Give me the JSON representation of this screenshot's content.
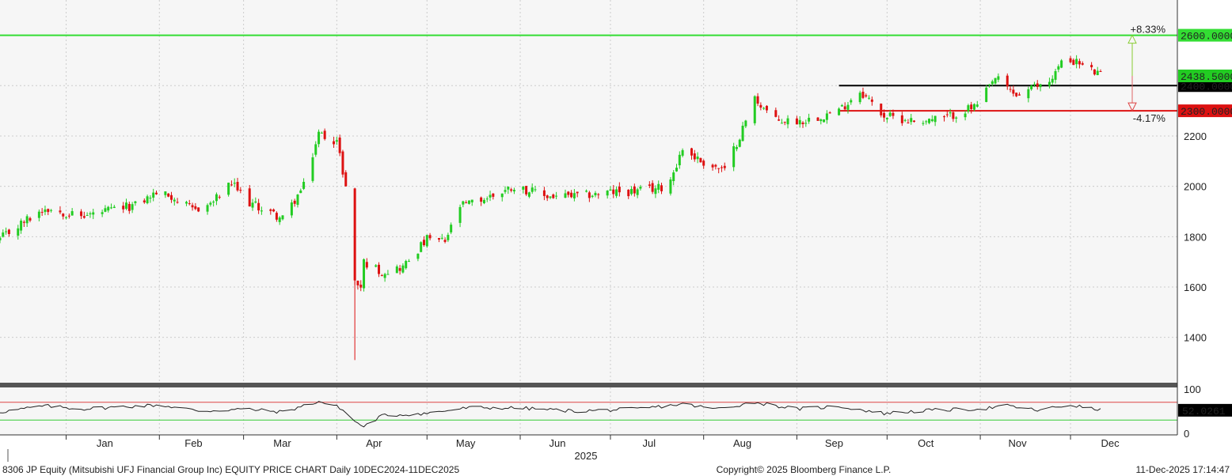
{
  "chart_data": [
    {
      "type": "candlestick",
      "title": "",
      "x_range": [
        "2024-12-10",
        "2025-12-11"
      ],
      "ylim": [
        1220,
        2740
      ],
      "y_ticks": [
        1400,
        1600,
        1800,
        2000,
        2200
      ],
      "y_tick_labels": [
        "1400",
        "1600",
        "1800",
        "2000",
        "2200"
      ],
      "month_ticks": [
        {
          "date": "2025-01-01",
          "label": "Jan"
        },
        {
          "date": "2025-02-01",
          "label": "Feb"
        },
        {
          "date": "2025-03-01",
          "label": "Mar"
        },
        {
          "date": "2025-04-01",
          "label": "Apr"
        },
        {
          "date": "2025-05-01",
          "label": "May"
        },
        {
          "date": "2025-06-01",
          "label": "Jun"
        },
        {
          "date": "2025-07-01",
          "label": "Jul"
        },
        {
          "date": "2025-08-01",
          "label": "Aug"
        },
        {
          "date": "2025-09-01",
          "label": "Sep"
        },
        {
          "date": "2025-10-01",
          "label": "Oct"
        },
        {
          "date": "2025-11-01",
          "label": "Nov"
        },
        {
          "date": "2025-12-01",
          "label": "Dec"
        }
      ],
      "year_label": "2025",
      "colors": {
        "up": "#22cc22",
        "down": "#dd1111",
        "resistance": "#33dd33",
        "support_black": "#000000",
        "support_red": "#dd1111"
      },
      "levels": [
        {
          "value": 2600,
          "label": "2600.0000",
          "color": "#33dd33",
          "from": "2024-12-10"
        },
        {
          "value": 2400,
          "label": "2400.0000",
          "color": "#000000",
          "from": "2025-09-15"
        },
        {
          "value": 2300,
          "label": "2300.0000",
          "color": "#dd1111",
          "from": "2025-09-15"
        }
      ],
      "last_price": {
        "value": 2438.5,
        "label": "2438.5000"
      },
      "pct_annotations": [
        {
          "text": "+8.33%",
          "value": 2600,
          "color": "#88bb22"
        },
        {
          "text": "-4.17%",
          "value": 2300,
          "color": "#dd1111"
        }
      ],
      "anchors": [
        [
          "2024-12-10",
          1790
        ],
        [
          "2024-12-18",
          1860
        ],
        [
          "2024-12-25",
          1915
        ],
        [
          "2025-01-06",
          1880
        ],
        [
          "2025-01-14",
          1900
        ],
        [
          "2025-01-24",
          1925
        ],
        [
          "2025-01-31",
          1975
        ],
        [
          "2025-02-05",
          1960
        ],
        [
          "2025-02-12",
          1905
        ],
        [
          "2025-02-18",
          1930
        ],
        [
          "2025-02-25",
          2010
        ],
        [
          "2025-03-03",
          1935
        ],
        [
          "2025-03-10",
          1895
        ],
        [
          "2025-03-14",
          1870
        ],
        [
          "2025-03-21",
          2000
        ],
        [
          "2025-03-26",
          2210
        ],
        [
          "2025-04-01",
          2180
        ],
        [
          "2025-04-04",
          2000
        ],
        [
          "2025-04-07",
          1620
        ],
        [
          "2025-04-09",
          1600
        ],
        [
          "2025-04-10",
          1700
        ],
        [
          "2025-04-16",
          1660
        ],
        [
          "2025-04-23",
          1680
        ],
        [
          "2025-05-01",
          1790
        ],
        [
          "2025-05-07",
          1780
        ],
        [
          "2025-05-12",
          1920
        ],
        [
          "2025-05-20",
          1950
        ],
        [
          "2025-05-30",
          2000
        ],
        [
          "2025-06-10",
          1960
        ],
        [
          "2025-06-20",
          1960
        ],
        [
          "2025-06-30",
          1975
        ],
        [
          "2025-07-10",
          1980
        ],
        [
          "2025-07-20",
          2000
        ],
        [
          "2025-07-25",
          2150
        ],
        [
          "2025-07-31",
          2100
        ],
        [
          "2025-08-08",
          2060
        ],
        [
          "2025-08-14",
          2230
        ],
        [
          "2025-08-18",
          2350
        ],
        [
          "2025-08-25",
          2260
        ],
        [
          "2025-09-03",
          2260
        ],
        [
          "2025-09-15",
          2300
        ],
        [
          "2025-09-22",
          2380
        ],
        [
          "2025-09-30",
          2280
        ],
        [
          "2025-10-10",
          2260
        ],
        [
          "2025-10-20",
          2270
        ],
        [
          "2025-10-31",
          2320
        ],
        [
          "2025-11-06",
          2430
        ],
        [
          "2025-11-13",
          2360
        ],
        [
          "2025-11-24",
          2420
        ],
        [
          "2025-11-28",
          2490
        ],
        [
          "2025-12-02",
          2500
        ],
        [
          "2025-12-11",
          2440
        ]
      ]
    },
    {
      "type": "line",
      "title": "",
      "ylim": [
        0,
        100
      ],
      "y_ticks": [
        0,
        100
      ],
      "y_tick_labels": [
        "0",
        "100"
      ],
      "bands": [
        {
          "value": 70,
          "color": "#dd4444"
        },
        {
          "value": 30,
          "color": "#33cc33"
        }
      ],
      "last_value": {
        "value": 52.0261,
        "label": "52.0261"
      },
      "anchors": [
        [
          "2024-12-10",
          48
        ],
        [
          "2024-12-25",
          62
        ],
        [
          "2025-01-06",
          55
        ],
        [
          "2025-01-20",
          60
        ],
        [
          "2025-02-01",
          64
        ],
        [
          "2025-02-15",
          50
        ],
        [
          "2025-03-01",
          55
        ],
        [
          "2025-03-14",
          48
        ],
        [
          "2025-03-26",
          72
        ],
        [
          "2025-04-02",
          58
        ],
        [
          "2025-04-08",
          22
        ],
        [
          "2025-04-10",
          15
        ],
        [
          "2025-04-16",
          40
        ],
        [
          "2025-05-01",
          45
        ],
        [
          "2025-05-15",
          58
        ],
        [
          "2025-06-01",
          57
        ],
        [
          "2025-06-20",
          50
        ],
        [
          "2025-07-10",
          55
        ],
        [
          "2025-07-25",
          66
        ],
        [
          "2025-08-05",
          55
        ],
        [
          "2025-08-18",
          70
        ],
        [
          "2025-09-01",
          55
        ],
        [
          "2025-09-15",
          61
        ],
        [
          "2025-09-30",
          45
        ],
        [
          "2025-10-15",
          52
        ],
        [
          "2025-11-01",
          55
        ],
        [
          "2025-11-10",
          62
        ],
        [
          "2025-11-20",
          52
        ],
        [
          "2025-12-01",
          64
        ],
        [
          "2025-12-11",
          52
        ]
      ]
    }
  ],
  "footer": {
    "left": "8306 JP Equity (Mitsubishi UFJ Financial Group Inc) EQUITY PRICE CHART Daily 10DEC2024-11DEC2025",
    "center": "Copyright© 2025 Bloomberg Finance L.P.",
    "right": "11-Dec-2025 17:14:47"
  }
}
